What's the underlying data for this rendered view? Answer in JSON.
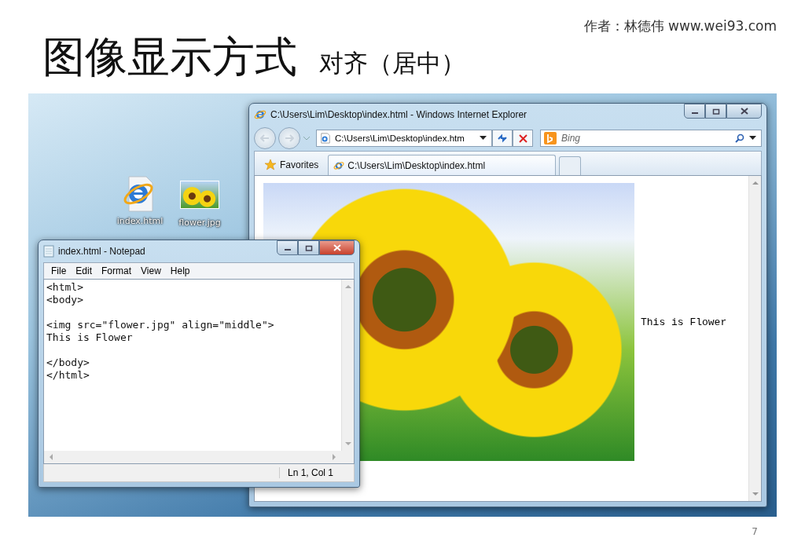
{
  "slide": {
    "title": "图像显示方式",
    "subtitle": "对齐（居中）",
    "author": "作者：林德伟 www.wei93.com",
    "page_number": "7"
  },
  "desktop_icons": [
    {
      "label": "index.html",
      "kind": "html"
    },
    {
      "label": "flower.jpg",
      "kind": "image"
    }
  ],
  "browser": {
    "title": "C:\\Users\\Lim\\Desktop\\index.html - Windows Internet Explorer",
    "address": "C:\\Users\\Lim\\Desktop\\index.htm",
    "search_placeholder": "Bing",
    "favorites": "Favorites",
    "tabs": [
      {
        "label": "C:\\Users\\Lim\\Desktop\\index.html",
        "selected": true
      }
    ],
    "page_text": "This is Flower"
  },
  "notepad": {
    "title": "index.html - Notepad",
    "menu": [
      "File",
      "Edit",
      "Format",
      "View",
      "Help"
    ],
    "text": "<html>\n<body>\n\n<img src=\"flower.jpg\" align=\"middle\">\nThis is Flower\n\n</body>\n</html>",
    "status": "Ln 1, Col 1"
  }
}
